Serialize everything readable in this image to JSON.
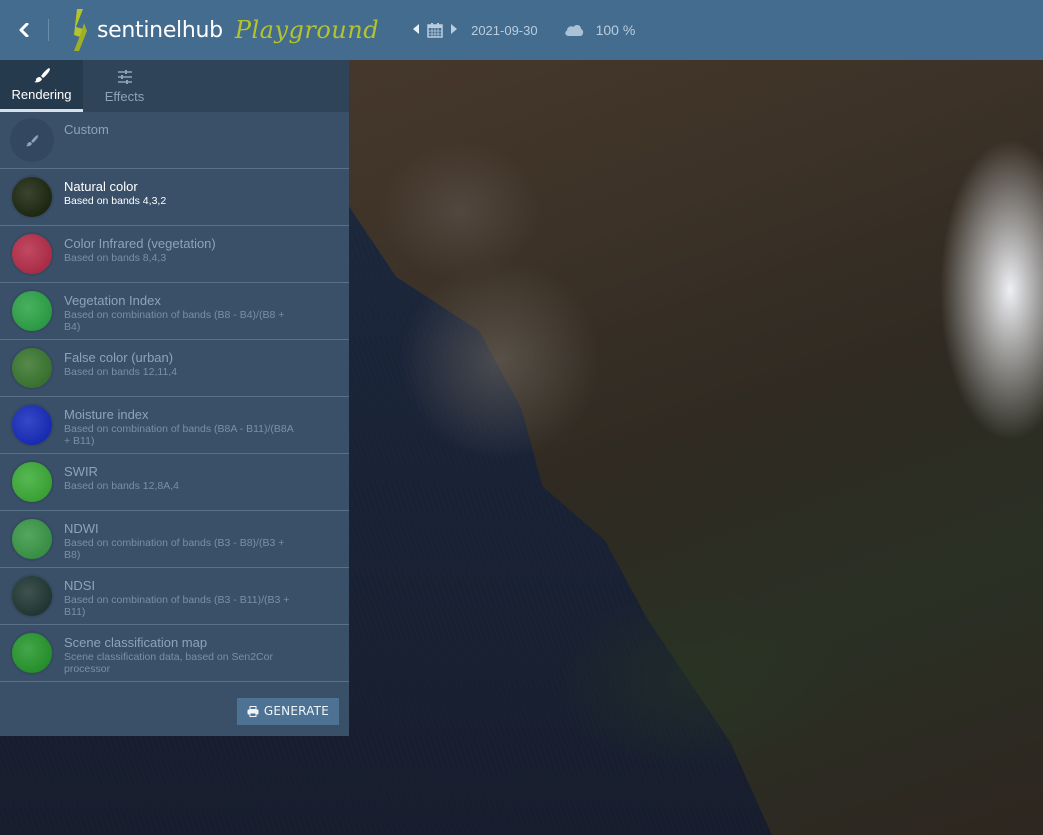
{
  "header": {
    "back_icon": "chevron-left-icon",
    "logo_text": "sentinelhub",
    "logo_sub": "Playground",
    "date_prev_icon": "caret-left-icon",
    "calendar_icon": "calendar-icon",
    "date_next_icon": "caret-right-icon",
    "date": "2021-09-30",
    "cloud_icon": "cloud-icon",
    "cloud_coverage": "100 %"
  },
  "tabs": [
    {
      "label": "Rendering",
      "icon": "paintbrush-icon",
      "active": true
    },
    {
      "label": "Effects",
      "icon": "sliders-icon",
      "active": false
    }
  ],
  "layers": [
    {
      "title": "Custom",
      "desc": "",
      "icon": "paintbrush-icon"
    },
    {
      "title": "Natural color",
      "desc": "Based on bands 4,3,2",
      "selected": true,
      "color": "#1f2a12"
    },
    {
      "title": "Color Infrared (vegetation)",
      "desc": "Based on bands 8,4,3",
      "color": "#b8304c"
    },
    {
      "title": "Vegetation Index",
      "desc": "Based on combination of bands (B8 - B4)/(B8 + B4)",
      "color": "#2fa64a"
    },
    {
      "title": "False color (urban)",
      "desc": "Based on bands 12,11,4",
      "color": "#3e7a32"
    },
    {
      "title": "Moisture index",
      "desc": "Based on combination of bands (B8A - B11)/(B8A + B11)",
      "color": "#1a2fc0"
    },
    {
      "title": "SWIR",
      "desc": "Based on bands 12,8A,4",
      "color": "#3fae3a"
    },
    {
      "title": "NDWI",
      "desc": "Based on combination of bands (B3 - B8)/(B3 + B8)",
      "color": "#3d9a4a"
    },
    {
      "title": "NDSI",
      "desc": "Based on combination of bands (B3 - B11)/(B3 + B11)",
      "color": "#243a36"
    },
    {
      "title": "Scene classification map",
      "desc": "Scene classification data, based on Sen2Cor processor",
      "color": "#2a9a30"
    }
  ],
  "footer": {
    "generate_label": "GENERATE",
    "generate_icon": "printer-icon"
  }
}
